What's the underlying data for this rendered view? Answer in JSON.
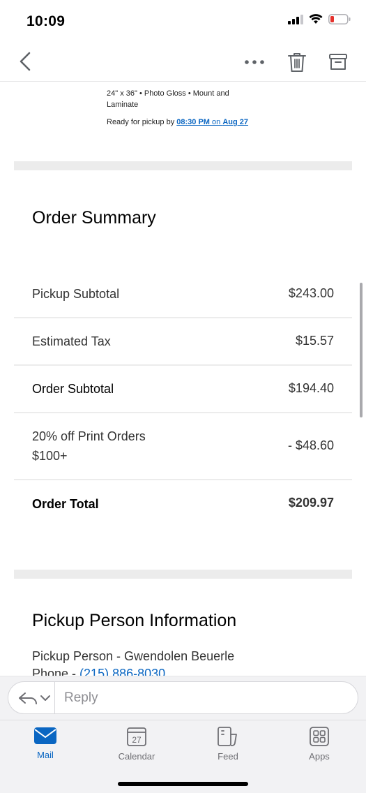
{
  "status_bar": {
    "time": "10:09"
  },
  "order_item": {
    "description": "24\" x 36\" • Photo Gloss • Mount and Laminate",
    "pickup_prefix": "Ready for pickup by ",
    "pickup_time": "08:30 PM",
    "pickup_on": " on ",
    "pickup_date": "Aug 27"
  },
  "order_summary": {
    "title": "Order Summary",
    "rows": [
      {
        "label": "Pickup Subtotal",
        "value": "$243.00"
      },
      {
        "label": "Estimated Tax",
        "value": "$15.57"
      },
      {
        "label": "Order Subtotal",
        "value": "$194.40"
      },
      {
        "label": "20% off Print Orders $100+",
        "value": "- $48.60"
      },
      {
        "label": "Order Total",
        "value": "$209.97"
      }
    ]
  },
  "pickup_person": {
    "title": "Pickup Person Information",
    "name_line": "Pickup Person - Gwendolen Beuerle",
    "phone_prefix": "Phone - ",
    "phone": "(215) 886-8030"
  },
  "reply_bar": {
    "placeholder": "Reply"
  },
  "tab_bar": {
    "tabs": [
      {
        "label": "Mail",
        "icon": "mail-icon",
        "active": true
      },
      {
        "label": "Calendar",
        "icon": "calendar-icon",
        "badge": "27"
      },
      {
        "label": "Feed",
        "icon": "feed-icon"
      },
      {
        "label": "Apps",
        "icon": "apps-icon"
      }
    ]
  },
  "colors": {
    "accent": "#0a66c2",
    "divider": "#ececec",
    "battery_low": "#e5322d"
  }
}
